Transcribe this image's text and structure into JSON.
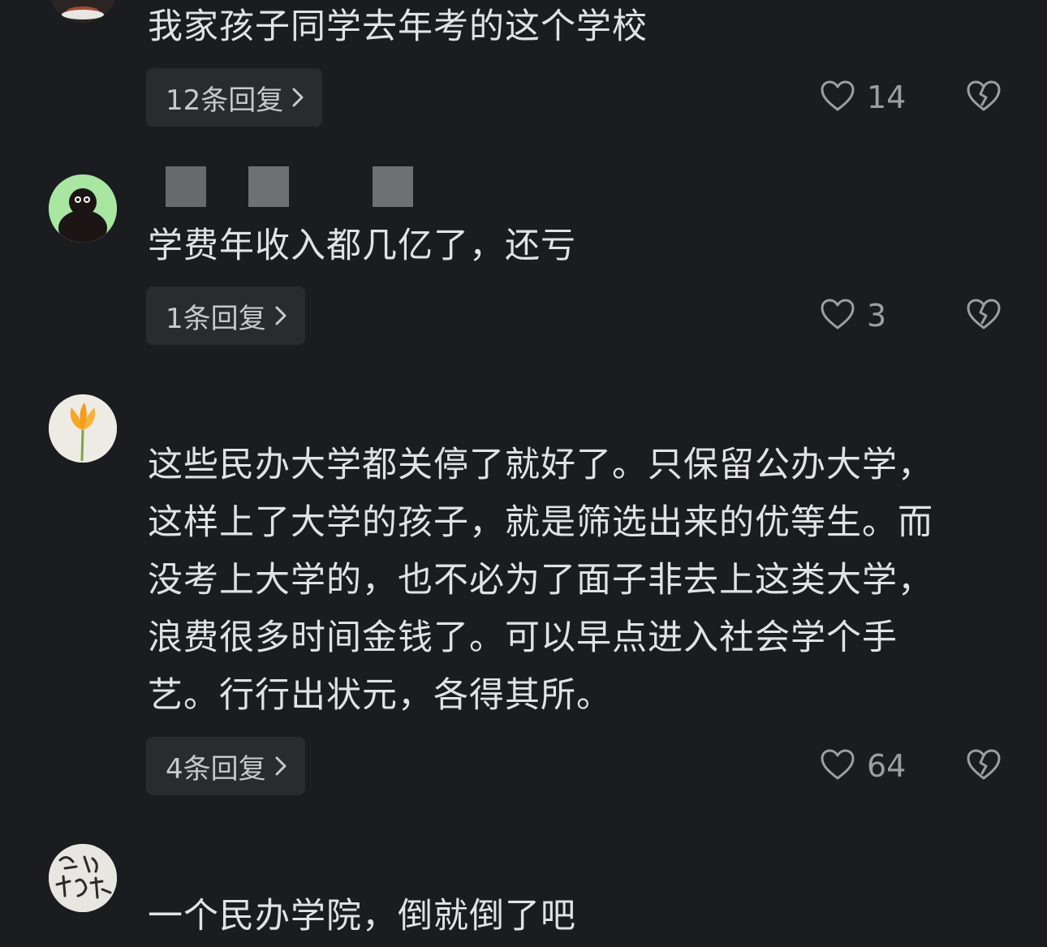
{
  "comments": [
    {
      "text": "我家孩子同学去年考的这个学校",
      "replies_label": "12条回复",
      "likes": "14"
    },
    {
      "text": "学费年收入都几亿了，还亏",
      "replies_label": "1条回复",
      "likes": "3"
    },
    {
      "text": "这些民办大学都关停了就好了。只保留公办大学，\n这样上了大学的孩子，就是筛选出来的优等生。而\n没考上大学的，也不必为了面子非去上这类大学，\n浪费很多时间金钱了。可以早点进入社会学个手\n艺。行行出状元，各得其所。",
      "replies_label": "4条回复",
      "likes": "64"
    },
    {
      "text": "一个民办学院，倒就倒了吧"
    }
  ],
  "icons": {
    "like": "heart-outline-icon",
    "dislike": "broken-heart-icon",
    "chevron": "chevron-right-icon"
  },
  "colors": {
    "background": "#1b1c20",
    "text": "#e2e2e4",
    "reply_button_bg": "#2a2b2f",
    "muted": "#9d9ea2"
  }
}
